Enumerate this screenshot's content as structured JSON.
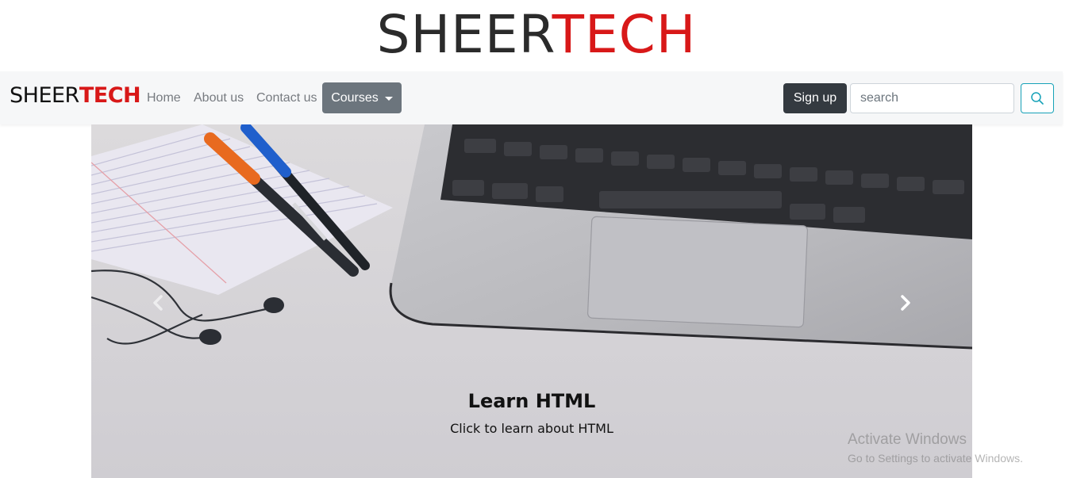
{
  "header": {
    "logo_dark": "SHEER",
    "logo_red": "TECH"
  },
  "navbar": {
    "brand_dark": "SHEER",
    "brand_red": "TECH",
    "links": [
      {
        "label": "Home"
      },
      {
        "label": "About us"
      },
      {
        "label": "Contact us"
      }
    ],
    "courses_label": "Courses",
    "signup_label": "Sign up",
    "search_placeholder": "search",
    "search_icon": "search-icon"
  },
  "carousel": {
    "caption_title": "Learn HTML",
    "caption_text": "Click to learn about HTML",
    "prev_icon": "chevron-left-icon",
    "next_icon": "chevron-right-icon"
  },
  "watermark": {
    "line1": "Activate Windows",
    "line2": "Go to Settings to activate Windows."
  },
  "colors": {
    "brand_red": "#d81818",
    "navbar_bg": "#f6f7f8",
    "courses_bg": "#6c757d",
    "signup_bg": "#343a40",
    "search_border": "#17a2b8"
  }
}
